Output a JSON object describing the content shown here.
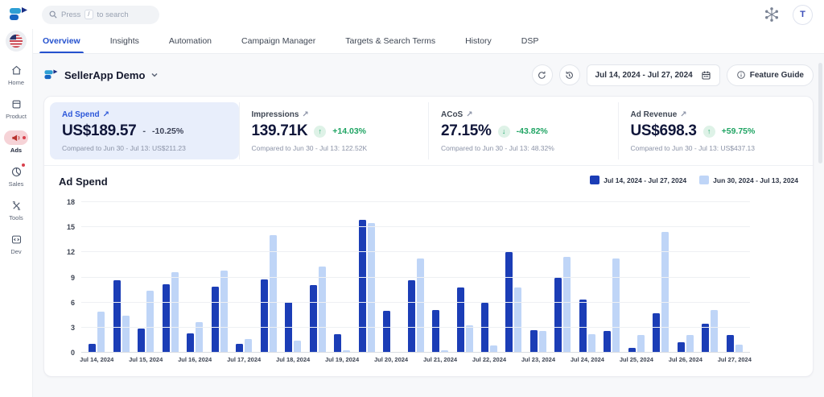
{
  "topbar": {
    "search_placeholder_pre": "Press",
    "search_keycap": "/",
    "search_placeholder_post": "to search",
    "avatar_initial": "T"
  },
  "icons": [
    "sellerapp-logo",
    "search",
    "slash-keycap",
    "snowflake",
    "us-flag",
    "home",
    "product-box",
    "ads-megaphone",
    "sales-pie",
    "tools",
    "dev-code",
    "chevron-down",
    "refresh",
    "history-clock",
    "calendar",
    "info-circle",
    "arrow-up-right",
    "arrow-up",
    "arrow-down"
  ],
  "tabs": {
    "items": [
      "Overview",
      "Insights",
      "Automation",
      "Campaign Manager",
      "Targets & Search Terms",
      "History",
      "DSP"
    ],
    "active": "Overview"
  },
  "sidebar": {
    "items": [
      {
        "label": "Home"
      },
      {
        "label": "Product"
      },
      {
        "label": "Ads",
        "active": true,
        "notification_dot": true
      },
      {
        "label": "Sales",
        "notification_dot": true
      },
      {
        "label": "Tools"
      },
      {
        "label": "Dev"
      }
    ]
  },
  "header": {
    "account_name": "SellerApp Demo",
    "date_range": "Jul 14, 2024 - Jul 27, 2024",
    "feature_guide_label": "Feature Guide"
  },
  "kpis": [
    {
      "label": "Ad Spend",
      "value": "US$189.57",
      "direction": "flat",
      "delta": "-10.25%",
      "compare": "Compared to Jun 30 - Jul 13: US$211.23",
      "selected": true
    },
    {
      "label": "Impressions",
      "value": "139.71K",
      "direction": "up",
      "delta": "+14.03%",
      "compare": "Compared to Jun 30 - Jul 13: 122.52K"
    },
    {
      "label": "ACoS",
      "value": "27.15%",
      "direction": "down",
      "delta": "-43.82%",
      "compare": "Compared to Jun 30 - Jul 13: 48.32%"
    },
    {
      "label": "Ad Revenue",
      "value": "US$698.3",
      "direction": "up",
      "delta": "+59.75%",
      "compare": "Compared to Jun 30 - Jul 13: US$437.13"
    }
  ],
  "chart_data": {
    "type": "bar",
    "title": "Ad Spend",
    "ylim": [
      0,
      18
    ],
    "yticks": [
      0,
      3,
      6,
      9,
      12,
      15,
      18
    ],
    "grid": true,
    "legend_position": "top-right",
    "x_labels": [
      "Jul 14, 2024",
      "",
      "Jul 15, 2024",
      "",
      "Jul 16, 2024",
      "",
      "Jul 17, 2024",
      "",
      "Jul 18, 2024",
      "",
      "Jul 19, 2024",
      "",
      "Jul 20, 2024",
      "",
      "Jul 21, 2024",
      "",
      "Jul 22, 2024",
      "",
      "Jul 23, 2024",
      "",
      "Jul 24, 2024",
      "",
      "Jul 25, 2024",
      "",
      "Jul 26, 2024",
      "",
      "Jul 27, 2024"
    ],
    "series": [
      {
        "name": "Jul 14, 2024 - Jul 27, 2024",
        "color": "#1b3db6",
        "values": [
          1.1,
          8.7,
          2.9,
          8.2,
          2.3,
          7.9,
          1.1,
          8.8,
          6.1,
          8.1,
          2.2,
          15.9,
          5.0,
          8.7,
          5.1,
          7.8,
          6.0,
          12.0,
          2.7,
          9.0,
          6.4,
          2.6,
          0.6,
          4.7,
          1.3,
          3.5,
          2.1
        ]
      },
      {
        "name": "Jun 30, 2024 - Jul 13, 2024",
        "color": "#bfd5f7",
        "values": [
          4.9,
          4.4,
          7.4,
          9.6,
          3.7,
          9.8,
          1.6,
          14.1,
          1.4,
          10.3,
          0.3,
          15.5,
          0.1,
          11.3,
          0.3,
          3.3,
          0.9,
          7.8,
          2.6,
          11.5,
          2.2,
          11.3,
          2.1,
          14.4,
          2.1,
          5.1,
          1.0
        ]
      }
    ]
  },
  "colors": {
    "accent_blue": "#2451ce",
    "kpi_selected_bg": "#e8eefb",
    "positive_green": "#1fa463",
    "bar_current": "#1b3db6",
    "bar_previous": "#bfd5f7",
    "ads_active_pill": "#f6d3d7",
    "notification_red": "#d8414d"
  }
}
